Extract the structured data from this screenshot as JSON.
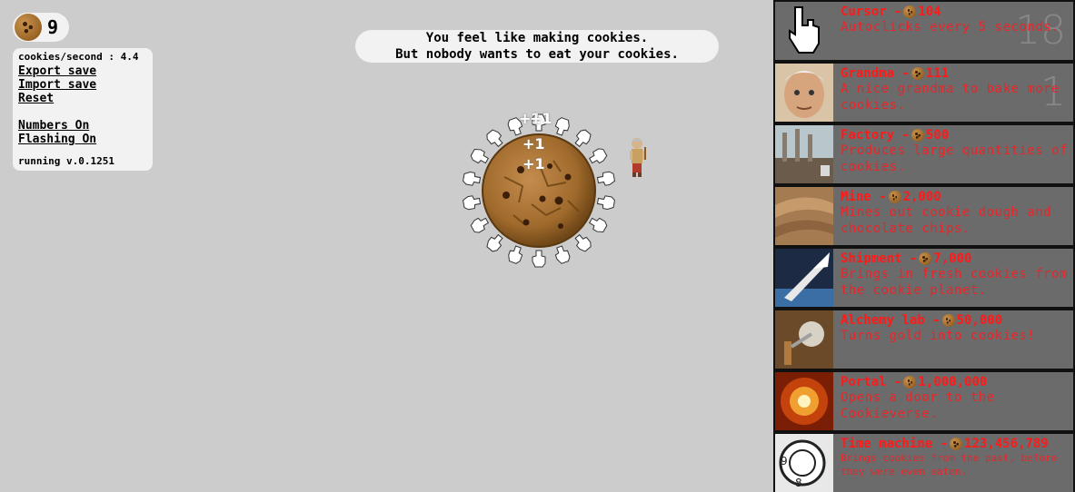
{
  "counter": {
    "cookies": "9",
    "icon": "cookie-icon"
  },
  "stats": {
    "rate": "cookies/second : 4.4",
    "export": "Export save",
    "import": "Import save",
    "reset": "Reset",
    "numbers": "Numbers On",
    "flashing": "Flashing On",
    "version": "running v.0.1251"
  },
  "message": {
    "line1": "You feel like making cookies.",
    "line2": "But nobody wants to eat your cookies."
  },
  "popups": [
    "+1",
    "+1",
    "+1",
    "+1"
  ],
  "colors": {
    "background": "#cccccc",
    "store_bg": "#6b6b6b",
    "title_red": "#ff1a1a",
    "desc_red": "#e8262a"
  },
  "store": [
    {
      "name": "Cursor - ",
      "price": "104",
      "desc": "Autoclicks every 5 seconds.",
      "count": "18",
      "icon": "cursor-icon"
    },
    {
      "name": "Grandma - ",
      "price": "111",
      "desc": "A nice grandma to bake more cookies.",
      "count": "1",
      "icon": "grandma-icon"
    },
    {
      "name": "Factory - ",
      "price": "500",
      "desc": "Produces large quantities of cookies.",
      "count": "",
      "icon": "factory-icon"
    },
    {
      "name": "Mine - ",
      "price": "2,000",
      "desc": "Mines out cookie dough and chocolate chips.",
      "count": "",
      "icon": "mine-icon"
    },
    {
      "name": "Shipment - ",
      "price": "7,000",
      "desc": "Brings in fresh cookies from the cookie planet.",
      "count": "",
      "icon": "shipment-icon"
    },
    {
      "name": "Alchemy lab - ",
      "price": "50,000",
      "desc": "Turns gold into cookies!",
      "count": "",
      "icon": "alchemy-lab-icon"
    },
    {
      "name": "Portal - ",
      "price": "1,000,000",
      "desc": "Opens a door to the Cookieverse.",
      "count": "",
      "icon": "portal-icon"
    },
    {
      "name": "Time machine - ",
      "price": "123,456,789",
      "desc": "Brings cookies from the past, before they were even eaten.",
      "count": "",
      "icon": "time-machine-icon"
    }
  ]
}
